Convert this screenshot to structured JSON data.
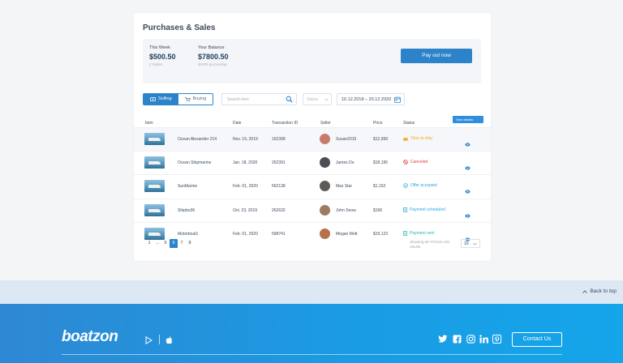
{
  "card": {
    "title": "Purchases & Sales"
  },
  "balance": {
    "week_label": "This Week",
    "week_value": "$500.50",
    "week_sub": "2 trades",
    "balance_label": "Your Balance",
    "balance_value": "$7800.50",
    "balance_sub": "$1800 processing",
    "payout_label": "Pay out now"
  },
  "filters": {
    "tabs": [
      {
        "label": "Selling",
        "icon": "tag-icon"
      },
      {
        "label": "Buying",
        "icon": "cart-icon"
      }
    ],
    "search_placeholder": "Search item",
    "status_placeholder": "Status",
    "date_range": "10.12.2018 – 20.12.2020"
  },
  "table": {
    "headers": {
      "item": "Item",
      "date": "Date",
      "tx": "Transaction ID",
      "seller": "Seller",
      "price": "Price",
      "status": "Status"
    },
    "rows": [
      {
        "name": "Ocean Alexander 214",
        "date": "Nov. 19, 2019",
        "tx": "162398",
        "seller": "Susan2015",
        "price": "$12,999",
        "status": "Time to ship",
        "status_color": "#f5a623",
        "status_icon": "box-icon",
        "avatar_color": "#c97a6a"
      },
      {
        "name": "Ocean Shipmarine",
        "date": "Jan. 18, 2020",
        "tx": "262391",
        "seller": "James Do",
        "price": "$18,195",
        "status": "Canceled",
        "status_color": "#e23b3b",
        "status_icon": "ban-icon",
        "avatar_color": "#4b4f55"
      },
      {
        "name": "SunMarine",
        "date": "Feb. 01, 2020",
        "tx": "562138",
        "seller": "Max Star",
        "price": "$1,152",
        "status": "Offer accepted",
        "status_color": "#2aa7e0",
        "status_icon": "check-circle-icon",
        "avatar_color": "#5d5a57"
      },
      {
        "name": "Shipbo36",
        "date": "Oct. 23, 2019",
        "tx": "262632",
        "seller": "John Snow",
        "price": "$196",
        "status": "Payment scheduled",
        "status_color": "#2aa7e0",
        "status_icon": "document-icon",
        "avatar_color": "#a07a5e"
      },
      {
        "name": "Motorboat1",
        "date": "Feb. 01, 2020",
        "tx": "598741",
        "seller": "Megan Mott",
        "price": "$19,123",
        "status": "Payment sent",
        "status_color": "#2bb7a9",
        "status_icon": "document-icon",
        "avatar_color": "#b8704a"
      }
    ],
    "tooltip": "View details"
  },
  "pagination": {
    "pages": [
      "1",
      "...",
      "5",
      "6",
      "7",
      "8"
    ],
    "current": "6",
    "showing": "Showing 60-70 from 100 results.",
    "per_page": "10"
  },
  "backtop": {
    "label": "Back to top"
  },
  "footer": {
    "logo": "boatzon",
    "stores": [
      "google-play-icon",
      "apple-icon"
    ],
    "social": [
      "twitter-icon",
      "facebook-icon",
      "instagram-icon",
      "linkedin-icon",
      "pinterest-icon"
    ],
    "contact_label": "Contact Us"
  }
}
